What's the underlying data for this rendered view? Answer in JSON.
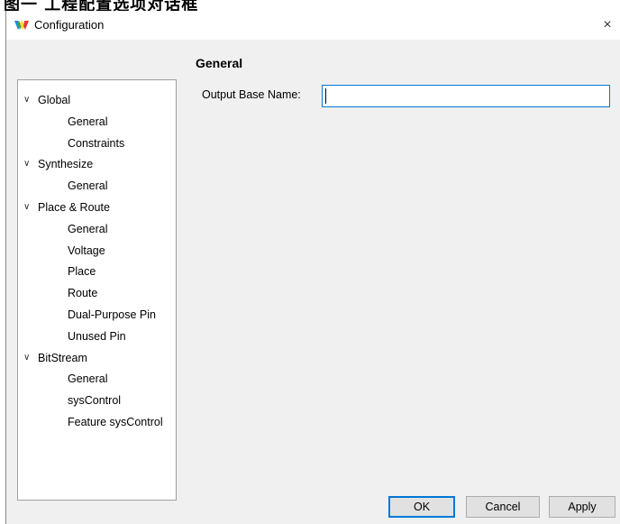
{
  "caption": "图一 工程配置选项对话框",
  "window": {
    "title": "Configuration",
    "icon": "gowin-logo-icon",
    "close_glyph": "×"
  },
  "tree": [
    {
      "label": "Global",
      "expanded": true,
      "children": [
        "General",
        "Constraints"
      ]
    },
    {
      "label": "Synthesize",
      "expanded": true,
      "children": [
        "General"
      ]
    },
    {
      "label": "Place & Route",
      "expanded": true,
      "children": [
        "General",
        "Voltage",
        "Place",
        "Route",
        "Dual-Purpose Pin",
        "Unused Pin"
      ]
    },
    {
      "label": "BitStream",
      "expanded": true,
      "children": [
        "General",
        "sysControl",
        "Feature sysControl"
      ]
    }
  ],
  "panel": {
    "section_title": "General",
    "output_base_name_label": "Output Base Name:",
    "output_base_name_value": ""
  },
  "buttons": {
    "ok": "OK",
    "cancel": "Cancel",
    "apply": "Apply"
  },
  "colors": {
    "accent": "#0078d7",
    "dialog_bg": "#f0f0f0"
  }
}
